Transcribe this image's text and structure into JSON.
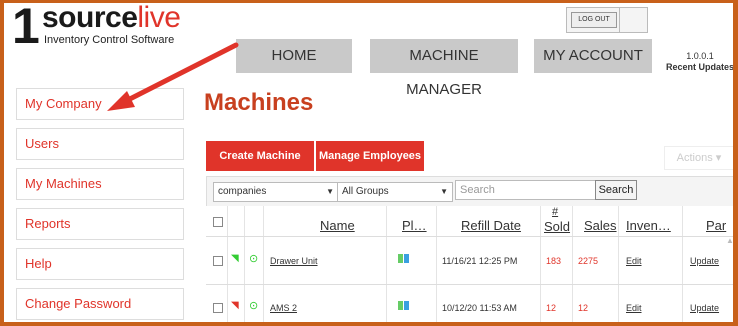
{
  "logo": {
    "one": "1",
    "source": "source",
    "live": "live",
    "tagline": "Inventory Control Software"
  },
  "header": {
    "logout_label": "LOG OUT",
    "version": "1.0.0.1",
    "recent_updates": "Recent Updates"
  },
  "nav": [
    "HOME",
    "MACHINE MANAGER",
    "MY ACCOUNT"
  ],
  "sidebar": {
    "items": [
      {
        "label": "My Company"
      },
      {
        "label": "Users"
      },
      {
        "label": "My Machines"
      },
      {
        "label": "Reports"
      },
      {
        "label": "Help"
      },
      {
        "label": "Change Password"
      }
    ]
  },
  "page_title": "Machines",
  "buttons": {
    "create": "Create Machine",
    "manage": "Manage Employees",
    "actions": "Actions"
  },
  "filters": {
    "companies": "companies",
    "groups": "All Groups",
    "search_placeholder": "Search",
    "search_button": "Search"
  },
  "table": {
    "headers": {
      "name": "Name",
      "pl": "Pl…",
      "refill": "Refill Date",
      "sold_hash": "#",
      "sold": "Sold",
      "sales": "Sales",
      "inventory": "Inven…",
      "par": "Par"
    },
    "rows": [
      {
        "name": "Drawer Unit",
        "refill": "11/16/21 12:25 PM",
        "sold": "183",
        "sales": "2275",
        "inventory": "Edit",
        "par": "Update"
      },
      {
        "name": "AMS 2",
        "refill": "10/12/20 11:53 AM",
        "sold": "12",
        "sales": "12",
        "inventory": "Edit",
        "par": "Update"
      }
    ]
  },
  "colors": {
    "accent": "#e0342a",
    "border": "#c8601a",
    "nav_bg": "#c9c9c9",
    "title": "#c8401f"
  }
}
